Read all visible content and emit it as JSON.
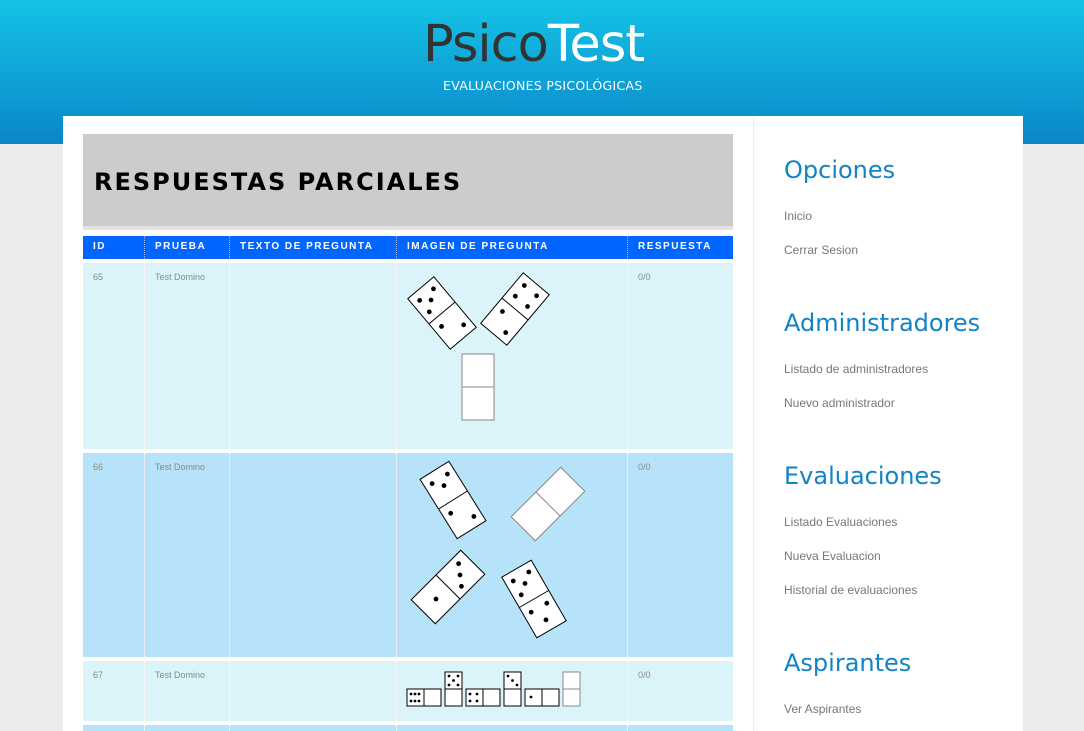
{
  "brand": {
    "logo_part1": "Psico",
    "logo_part2": "Test",
    "tagline": "EVALUACIONES PSICOLÓGICAS"
  },
  "main": {
    "title": "RESPUESTAS PARCIALES"
  },
  "table": {
    "columns": [
      "ID",
      "PRUEBA",
      "TEXTO DE PREGUNTA",
      "IMAGEN DE PREGUNTA",
      "RESPUESTA"
    ],
    "rows": [
      {
        "id": "65",
        "prueba": "Test Domino",
        "texto": "",
        "imagen": "domino-puzzle-65",
        "respuesta": "0/0"
      },
      {
        "id": "66",
        "prueba": "Test Domino",
        "texto": "",
        "imagen": "domino-puzzle-66",
        "respuesta": "0/0"
      },
      {
        "id": "67",
        "prueba": "Test Domino",
        "texto": "",
        "imagen": "domino-puzzle-67",
        "respuesta": "0/0"
      }
    ]
  },
  "sidebar": {
    "sections": [
      {
        "heading": "Opciones",
        "links": [
          "Inicio",
          "Cerrar Sesion"
        ]
      },
      {
        "heading": "Administradores",
        "links": [
          "Listado de administradores",
          "Nuevo administrador"
        ]
      },
      {
        "heading": "Evaluaciones",
        "links": [
          "Listado Evaluaciones",
          "Nueva Evaluacion",
          "Historial de evaluaciones"
        ]
      },
      {
        "heading": "Aspirantes",
        "links": [
          "Ver Aspirantes"
        ]
      }
    ]
  },
  "colors": {
    "header_top": "#14c3e6",
    "header_bottom": "#0a86c8",
    "table_header": "#0066ff",
    "row_light": "#dbf4fa",
    "row_dark": "#b7e3fa",
    "sidebar_heading": "#1283c4"
  }
}
